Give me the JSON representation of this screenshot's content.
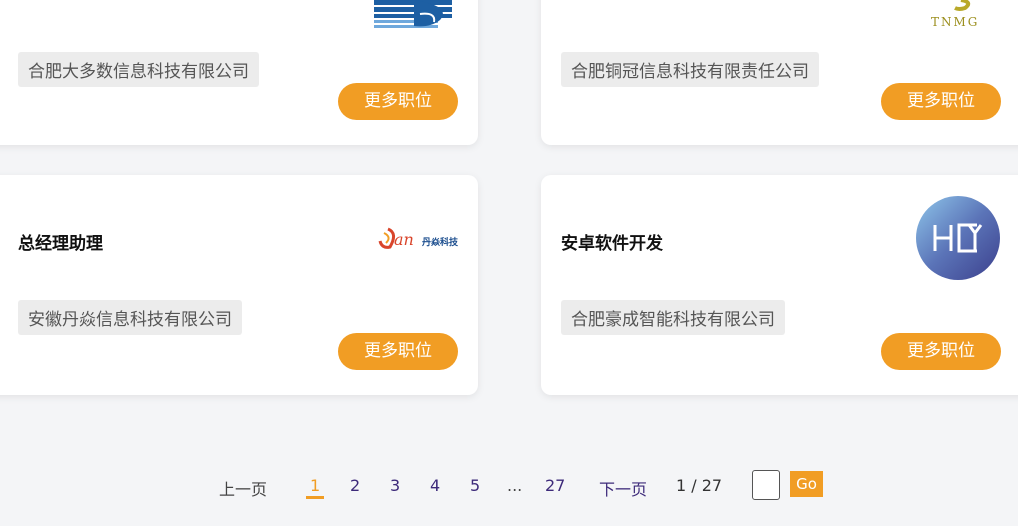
{
  "cards": [
    {
      "title": "",
      "company": "合肥大多数信息科技有限公司",
      "button": "更多职位",
      "logo_icon": "blue-striped-globe-logo"
    },
    {
      "title": "",
      "company": "合肥铜冠信息科技有限责任公司",
      "button": "更多职位",
      "logo_icon": "tnmg-logo",
      "logo_text": "TNMG"
    },
    {
      "title": "总经理助理",
      "company": "安徽丹焱信息科技有限公司",
      "button": "更多职位",
      "logo_icon": "danyan-logo",
      "logo_text": "an",
      "logo_sub": "丹焱科技"
    },
    {
      "title": "安卓软件开发",
      "company": "合肥豪成智能科技有限公司",
      "button": "更多职位",
      "logo_icon": "hc-circle-logo"
    }
  ],
  "pagination": {
    "prev": "上一页",
    "pages": [
      "1",
      "2",
      "3",
      "4",
      "5"
    ],
    "ellipsis": "...",
    "last": "27",
    "next": "下一页",
    "count": "1 / 27",
    "go": "Go"
  },
  "colors": {
    "accent": "#f19d24",
    "tag_bg": "#ececec",
    "page_link": "#3d2a7a"
  }
}
